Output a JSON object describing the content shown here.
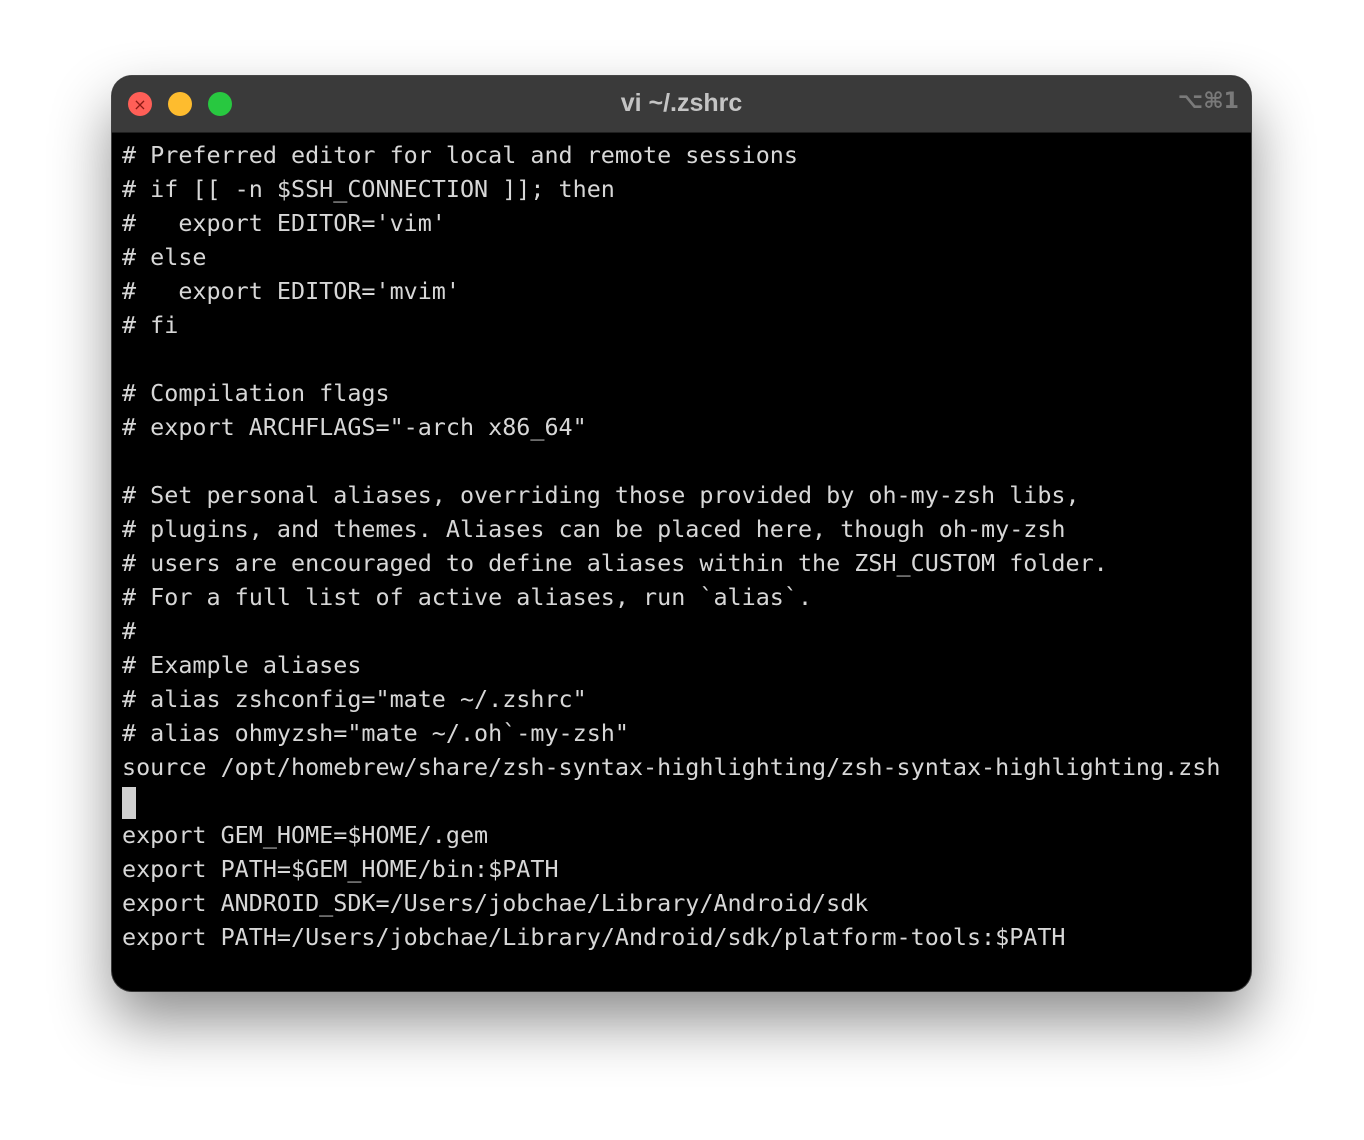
{
  "window": {
    "title": "vi ~/.zshrc",
    "shortcut": "⌥⌘1",
    "close_glyph": "×"
  },
  "editor": {
    "lines": [
      "# Preferred editor for local and remote sessions",
      "# if [[ -n $SSH_CONNECTION ]]; then",
      "#   export EDITOR='vim'",
      "# else",
      "#   export EDITOR='mvim'",
      "# fi",
      "",
      "# Compilation flags",
      "# export ARCHFLAGS=\"-arch x86_64\"",
      "",
      "# Set personal aliases, overriding those provided by oh-my-zsh libs,",
      "# plugins, and themes. Aliases can be placed here, though oh-my-zsh",
      "# users are encouraged to define aliases within the ZSH_CUSTOM folder.",
      "# For a full list of active aliases, run `alias`.",
      "#",
      "# Example aliases",
      "# alias zshconfig=\"mate ~/.zshrc\"",
      "# alias ohmyzsh=\"mate ~/.oh`-my-zsh\"",
      "source /opt/homebrew/share/zsh-syntax-highlighting/zsh-syntax-highlighting.zsh",
      "",
      "export GEM_HOME=$HOME/.gem",
      "export PATH=$GEM_HOME/bin:$PATH",
      "export ANDROID_SDK=/Users/jobchae/Library/Android/sdk",
      "export PATH=/Users/jobchae/Library/Android/sdk/platform-tools:$PATH"
    ]
  },
  "colors": {
    "background": "#000000",
    "text": "#d7d7d7",
    "titlebar": "#3a3a3a",
    "close": "#ff5f57",
    "minimize": "#febc2e",
    "maximize": "#28c840"
  }
}
